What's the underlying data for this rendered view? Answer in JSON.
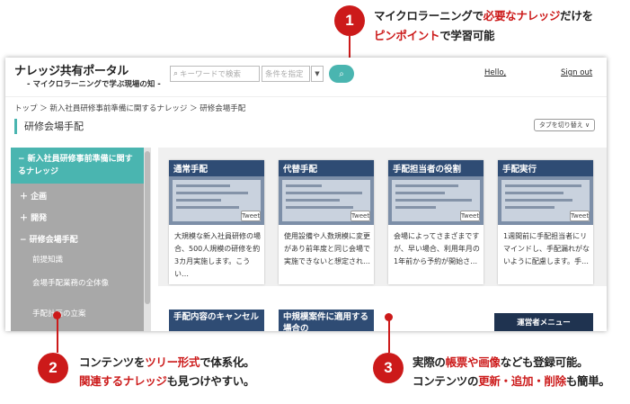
{
  "callouts": {
    "c1": {
      "number": "1",
      "line1_a": "マイクロラーニングで",
      "line1_b": "必要なナレッジ",
      "line1_c": "だけを",
      "line2_a": "ピンポイント",
      "line2_b": "で学習可能"
    },
    "c2": {
      "number": "2",
      "line1_a": "コンテンツを",
      "line1_b": "ツリー形式",
      "line1_c": "で体系化。",
      "line2_a": "関連するナレッジ",
      "line2_b": "も見つけやすい。"
    },
    "c3": {
      "number": "3",
      "line1_a": "実際の",
      "line1_b": "帳票や画像",
      "line1_c": "なども登録可能。",
      "line2_a": "コンテンツの",
      "line2_b": "更新・追加・削除",
      "line2_c": "も簡単。"
    }
  },
  "app": {
    "title": "ナレッジ共有ポータル",
    "subtitle": "- マイクロラーニングで学ぶ現場の知 -",
    "search_placeholder": "キーワードで検索",
    "condition_placeholder": "条件を指定",
    "hello": "Hello,",
    "signout": "Sign out"
  },
  "breadcrumb": "トップ ＞ 新入社員研修事前準備に関するナレッジ ＞ 研修会場手配",
  "page_title": "研修会場手配",
  "tab_switch": "タブを切り替え",
  "sidebar": {
    "active": "− 新入社員研修事前準備に関するナレッジ",
    "items": [
      "＋ 企画",
      "＋ 開発",
      "− 研修会場手配"
    ],
    "subitems": [
      "前提知識",
      "会場手配業務の全体像",
      "手配計画の立案"
    ]
  },
  "cards": [
    {
      "title": "通常手配",
      "text": "大規模な新入社員研修の場合、500人規模の研修を約3カ月実施します。こうい…",
      "tweet": "Tweet"
    },
    {
      "title": "代替手配",
      "text": "使用設備や人数規模に変更があり前年度と同じ会場で実施できないと想定され…",
      "tweet": "Tweet"
    },
    {
      "title": "手配担当者の役割",
      "text": "会場によってさまざまですが、早い場合、利用年月の1年前から予約が開始さ…",
      "tweet": "Tweet"
    },
    {
      "title": "手配実行",
      "text": "1週間前に手配担当者にリマインドし、手配漏れがないように配慮します。手…",
      "tweet": "Tweet"
    }
  ],
  "cards2": [
    {
      "title": "手配内容のキャンセル"
    },
    {
      "title": "中規模案件に適用する場合の"
    }
  ],
  "admin_menu": "運営者メニュー",
  "colors": {
    "accent": "#cc1a1a",
    "teal": "#4ab5b0",
    "navy": "#2f4c74"
  }
}
